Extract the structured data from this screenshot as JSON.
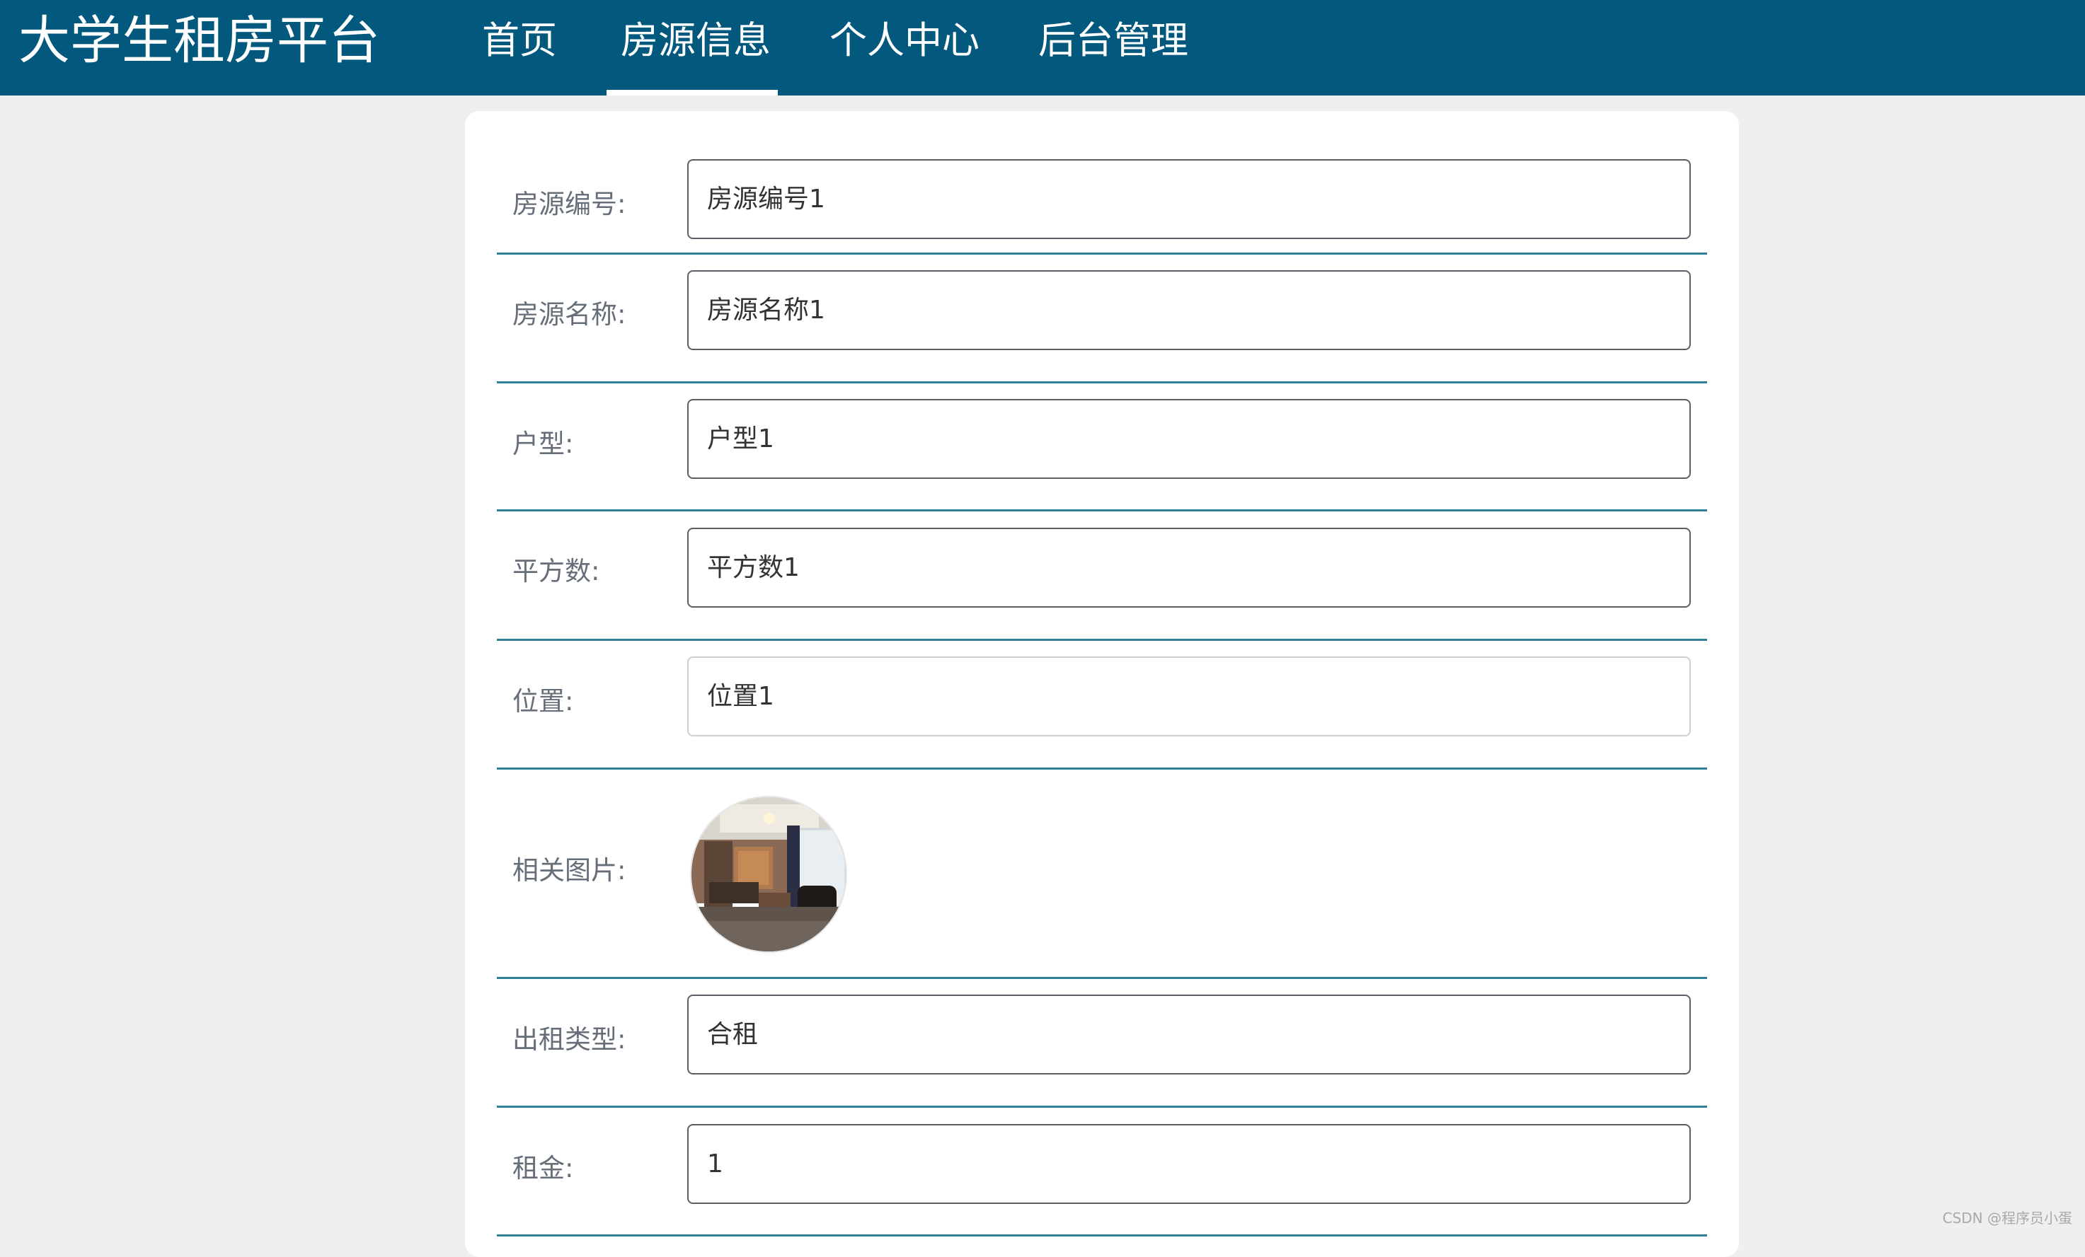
{
  "header": {
    "brand": "大学生租房平台",
    "nav": [
      {
        "label": "首页",
        "active": false
      },
      {
        "label": "房源信息",
        "active": true
      },
      {
        "label": "个人中心",
        "active": false
      },
      {
        "label": "后台管理",
        "active": false
      }
    ],
    "bg_color": "#02587d",
    "text_color": "#ffffff"
  },
  "form": {
    "fields": [
      {
        "label": "房源编号:",
        "value": "房源编号1"
      },
      {
        "label": "房源名称:",
        "value": "房源名称1"
      },
      {
        "label": "户型:",
        "value": "户型1"
      },
      {
        "label": "平方数:",
        "value": "平方数1"
      },
      {
        "label": "位置:",
        "value": "位置1"
      },
      {
        "label": "相关图片:",
        "value": ""
      },
      {
        "label": "出租类型:",
        "value": "合租"
      },
      {
        "label": "租金:",
        "value": "1"
      }
    ],
    "divider_color": "#2f7f99"
  },
  "watermark": "CSDN @程序员小蛋"
}
